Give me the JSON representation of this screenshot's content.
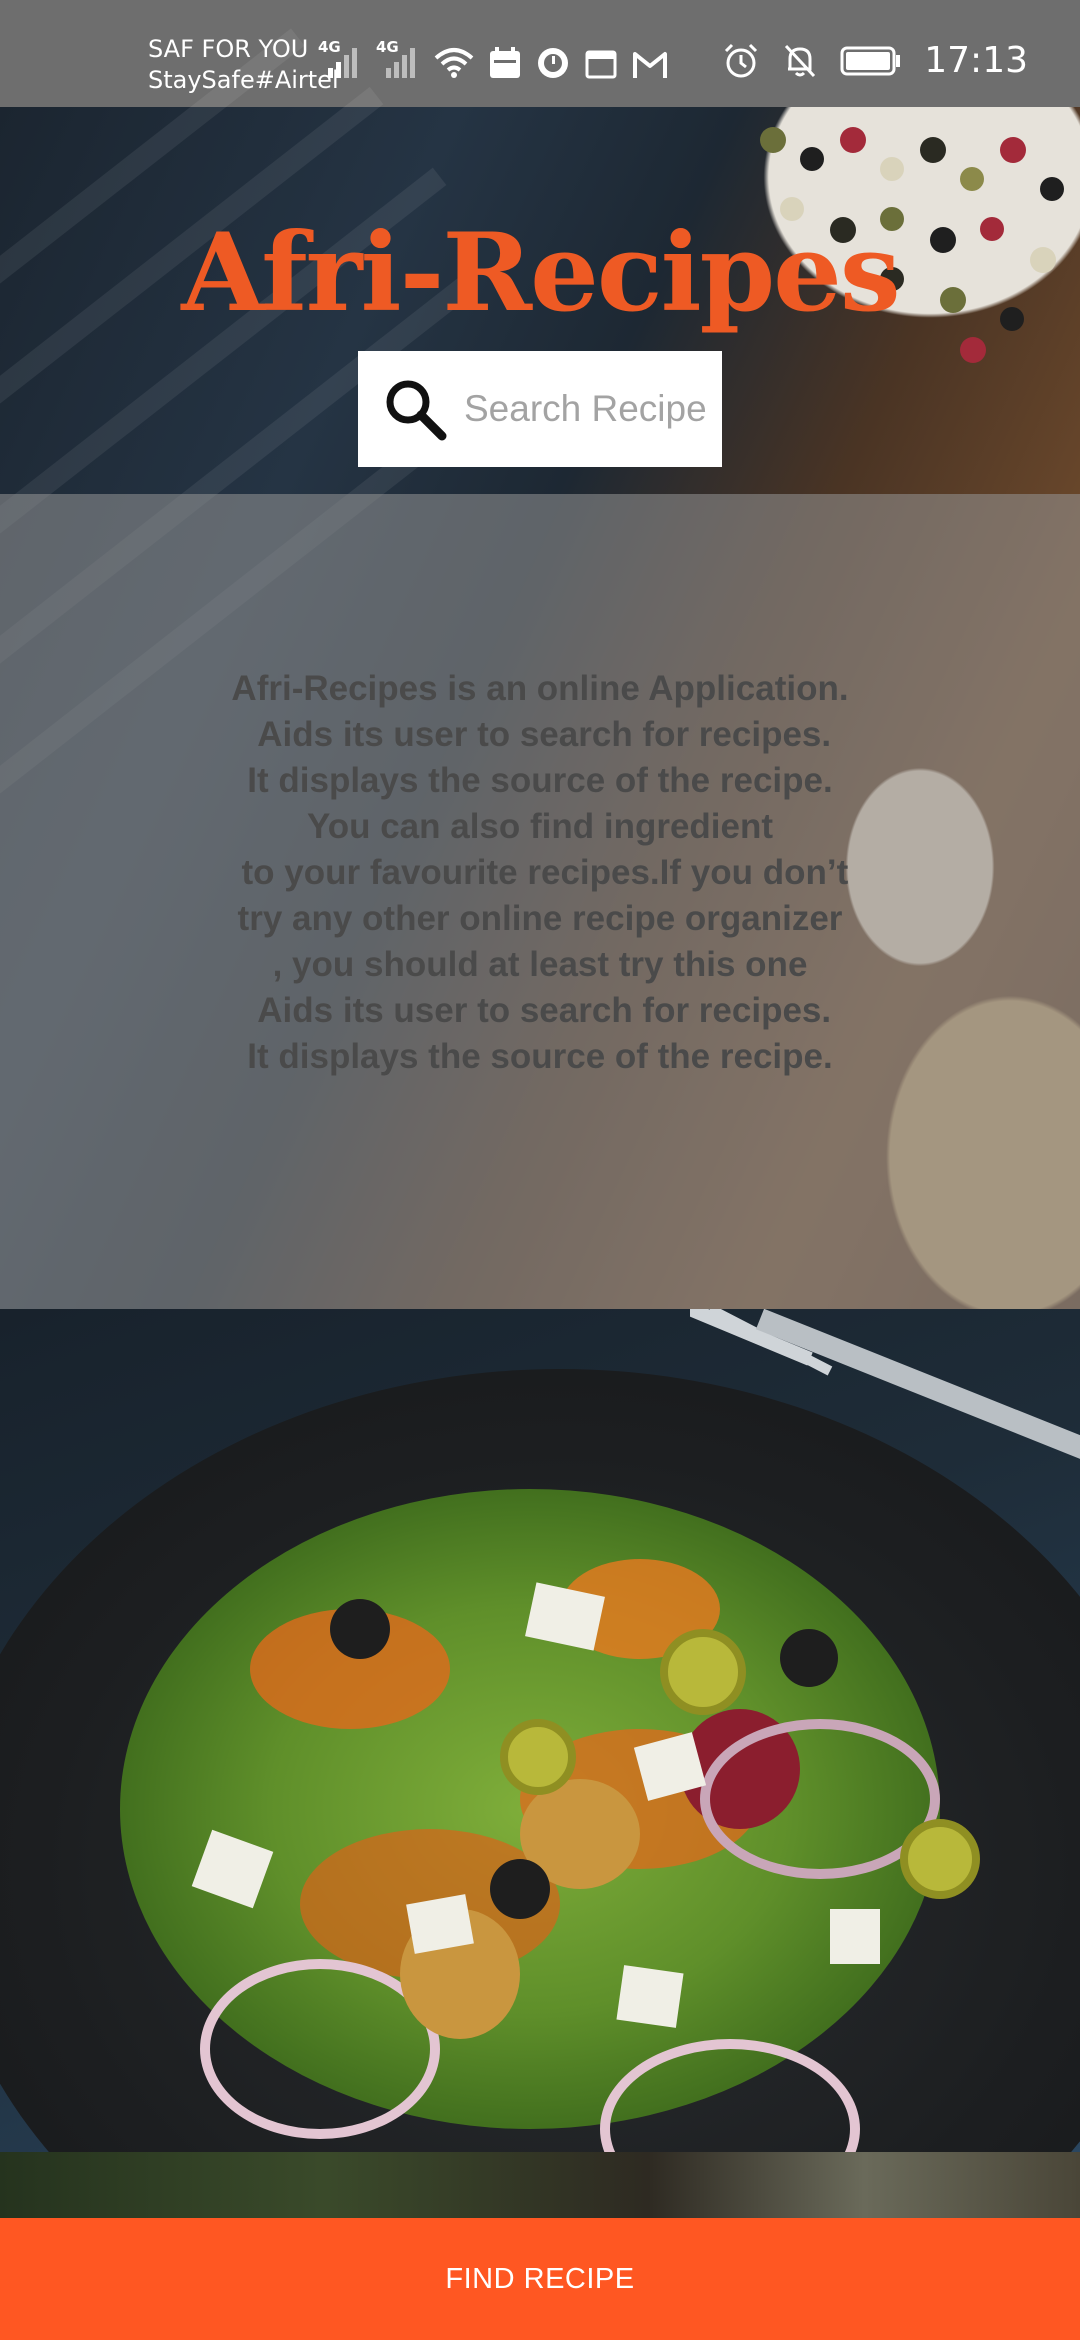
{
  "status_bar": {
    "carrier_line1": "SAF FOR YOU",
    "carrier_line2": "StaySafe#Airtel",
    "network1": "4G",
    "network2": "4G",
    "time": "17:13",
    "icons_left": [
      "signal-icon",
      "signal-icon",
      "wifi-icon",
      "calendar-icon",
      "clock-app-icon",
      "calendar-icon",
      "gmail-icon"
    ],
    "icons_right": [
      "alarm-icon",
      "mute-icon",
      "battery-icon"
    ]
  },
  "header": {
    "title": "Afri-Recipes",
    "title_color": "#ee5a24"
  },
  "search": {
    "placeholder": "Search Recipe",
    "value": ""
  },
  "info": {
    "lines": [
      "Afri-Recipes is an online Application.",
      " Aids its user to search for recipes.",
      "It displays the source of the recipe.",
      "You can also find ingredient",
      " to your favourite recipes.If you don’t",
      "try any other online recipe organizer",
      ", you should at least try this one",
      " Aids its user to search for recipes.",
      "It displays the source of the recipe."
    ]
  },
  "footer": {
    "button_label": "FIND RECIPE",
    "button_color": "#ff5722"
  }
}
